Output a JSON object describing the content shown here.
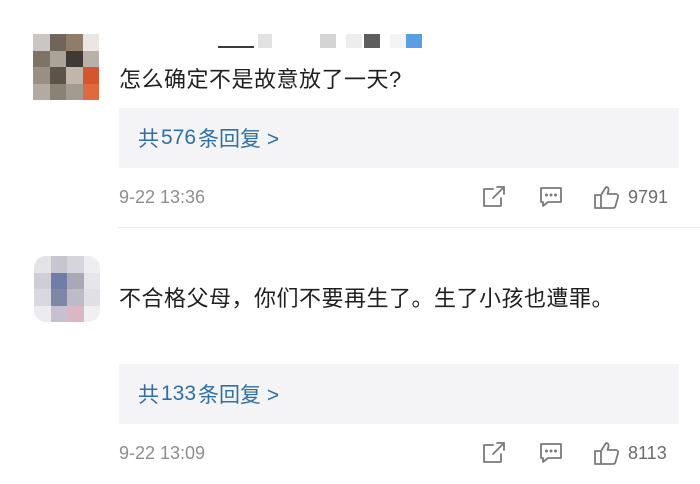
{
  "comments": [
    {
      "text": "怎么确定不是故意放了一天?",
      "replies": {
        "prefix": "共",
        "count": "576",
        "suffix": "条回复 >"
      },
      "time": "9-22 13:36",
      "likes": "9791"
    },
    {
      "text": "不合格父母，你们不要再生了。生了小孩也遭罪。",
      "replies": {
        "prefix": "共",
        "count": "133",
        "suffix": "条回复 >"
      },
      "time": "9-22 13:09",
      "likes": "8113"
    }
  ],
  "icons": {
    "share": "share-icon",
    "reply": "comment-icon",
    "like": "thumbs-up-icon"
  },
  "colors": {
    "link": "#2f6fa6",
    "reply_box_bg": "#f4f4f6",
    "meta_text": "#8e8e8e"
  }
}
